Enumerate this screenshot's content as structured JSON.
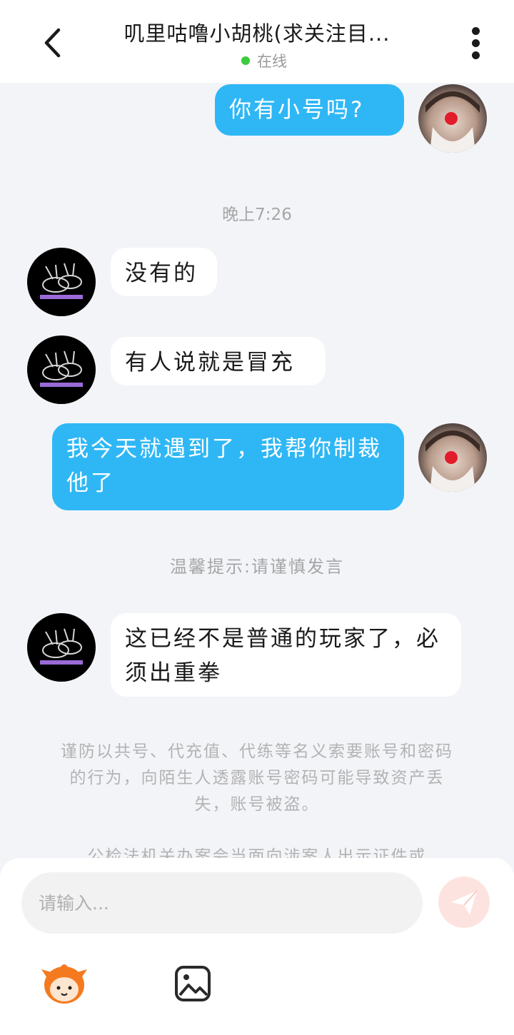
{
  "header": {
    "title": "叽里咕噜小胡桃(求关注目...",
    "status": "在线",
    "status_color": "#3ccb3c"
  },
  "messages": [
    {
      "from": "self",
      "text": "你有小号吗?"
    },
    {
      "from": "time",
      "text": "晚上7:26"
    },
    {
      "from": "other",
      "text": "没有的"
    },
    {
      "from": "other",
      "text": "有人说就是冒充"
    },
    {
      "from": "self",
      "text": "我今天就遇到了，我帮你制裁他了"
    },
    {
      "from": "tip",
      "text": "温馨提示:请谨慎发言"
    },
    {
      "from": "other",
      "text": "这已经不是普通的玩家了，必须出重拳"
    }
  ],
  "warning": {
    "text": "谨防以共号、代充值、代练等名义索要账号和密码的行为，向陌生人透露账号密码可能导致资产丢失，账号被盗。",
    "text2": "公检法机关办案会当面向涉案人出示证件或"
  },
  "composer": {
    "placeholder": "请输入...",
    "send_icon": "send-icon",
    "emoji_icon": "emoji-mascot-icon",
    "image_icon": "image-icon"
  },
  "colors": {
    "self_bubble": "#2fb7f5",
    "other_bubble": "#ffffff",
    "background": "#f3f4f8",
    "send_button": "#fde3e0"
  }
}
